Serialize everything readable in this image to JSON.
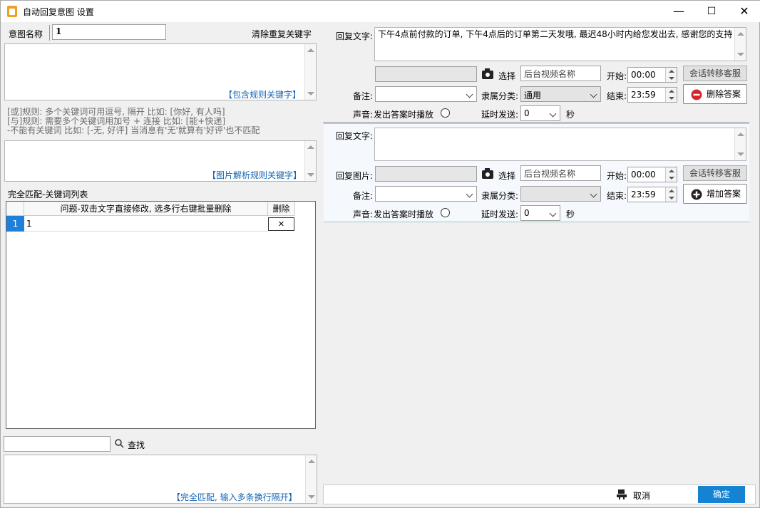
{
  "window": {
    "title": "自动回复意图 设置",
    "min": "—",
    "max": "☐",
    "close": "✕"
  },
  "left": {
    "intent_label": "意图名称",
    "intent_value": "1",
    "dedupe_label": "清除重复关键字",
    "include_link": "【包含规则关键字】",
    "rules": [
      "[或]规则: 多个关键词可用逗号, 隔开 比如: [你好, 有人吗]",
      "[与]规则: 需要多个关键词用加号 + 连接 比如: [能+快递]",
      "-不能有关键词 比如: [-无, 好评] 当消息有'无'就算有'好评'也不匹配"
    ],
    "image_link": "【图片解析规则关键字】",
    "list_title": "完全匹配-关键词列表",
    "table": {
      "headers": [
        "问题-双击文字直接修改, 选多行右键批量删除",
        "删除"
      ],
      "rows": [
        {
          "num": "1",
          "text": "1",
          "del": "✕"
        }
      ]
    },
    "search_label": "查找",
    "search_value": "",
    "exact_link": "【完全匹配, 输入多条换行隔开】"
  },
  "answer1": {
    "reply_label": "回复文字:",
    "reply_text": "下午4点前付款的订单, 下午4点后的订单第二天发哦, 最迟48小时内给您发出去, 感谢您的支持",
    "select_label": "选择",
    "video_placeholder": "后台视频名称",
    "start_label": "开始:",
    "start_value": "00:00",
    "end_label": "结束:",
    "end_value": "23:59",
    "transfer_btn": "会话转移客服",
    "note_label": "备注:",
    "category_label": "隶属分类:",
    "category_value": "通用",
    "delete_btn": "删除答案",
    "sound_label": "声音:",
    "sound_text": "发出答案时播放",
    "delay_label": "延时发送:",
    "delay_value": "0",
    "delay_unit": "秒"
  },
  "answer2": {
    "reply_label": "回复文字:",
    "image_label": "回复图片:",
    "select_label": "选择",
    "video_placeholder": "后台视频名称",
    "start_label": "开始:",
    "start_value": "00:00",
    "end_label": "结束:",
    "end_value": "23:59",
    "transfer_btn": "会话转移客服",
    "note_label": "备注:",
    "category_label": "隶属分类:",
    "add_btn": "增加答案",
    "sound_label": "声音:",
    "sound_text": "发出答案时播放",
    "delay_label": "延时发送:",
    "delay_value": "0",
    "delay_unit": "秒"
  },
  "footer": {
    "cancel": "取消",
    "ok": "确定"
  },
  "colors": {
    "accent": "#1682d2",
    "link": "#1464b4",
    "delete_icon": "#d9262c"
  }
}
